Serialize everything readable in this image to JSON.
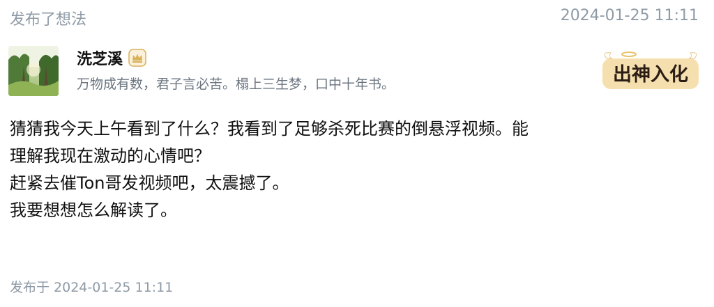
{
  "header": {
    "action": "发布了想法",
    "timestamp": "2024-01-25 11:11"
  },
  "author": {
    "name": "洗芝溪",
    "motto": "万物成有数，君子言必苦。榻上三生梦，口中十年书。",
    "badge_icon": "crown-icon",
    "title_badge_text": "出神入化"
  },
  "post": {
    "lines": [
      "猜猜我今天上午看到了什么？我看到了足够杀死比赛的倒悬浮视频。能",
      "理解我现在激动的心情吧？",
      "赶紧去催Ton哥发视频吧，太震撼了。",
      "我要想想怎么解读了。"
    ]
  },
  "footer": {
    "published": "发布于 2024-01-25 11:11"
  },
  "colors": {
    "meta_text": "#8e9aa6",
    "body_text": "#111111",
    "badge_gold": "#d8b15a"
  }
}
